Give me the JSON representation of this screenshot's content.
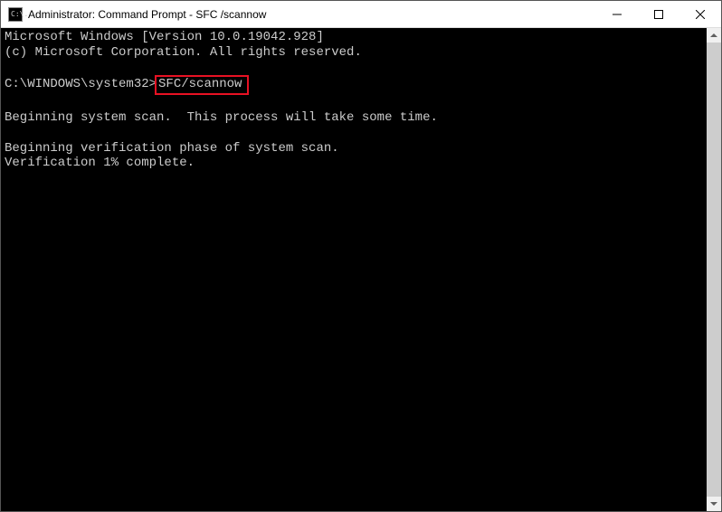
{
  "titlebar": {
    "icon_text": "C:\\.",
    "title": "Administrator: Command Prompt - SFC /scannow"
  },
  "terminal": {
    "line1": "Microsoft Windows [Version 10.0.19042.928]",
    "line2": "(c) Microsoft Corporation. All rights reserved.",
    "blank1": "",
    "prompt_prefix": "C:\\WINDOWS\\system32>",
    "prompt_command": "SFC/scannow",
    "blank2": "",
    "line_scan": "Beginning system scan.  This process will take some time.",
    "blank3": "",
    "line_verify1": "Beginning verification phase of system scan.",
    "line_verify2": "Verification 1% complete."
  }
}
